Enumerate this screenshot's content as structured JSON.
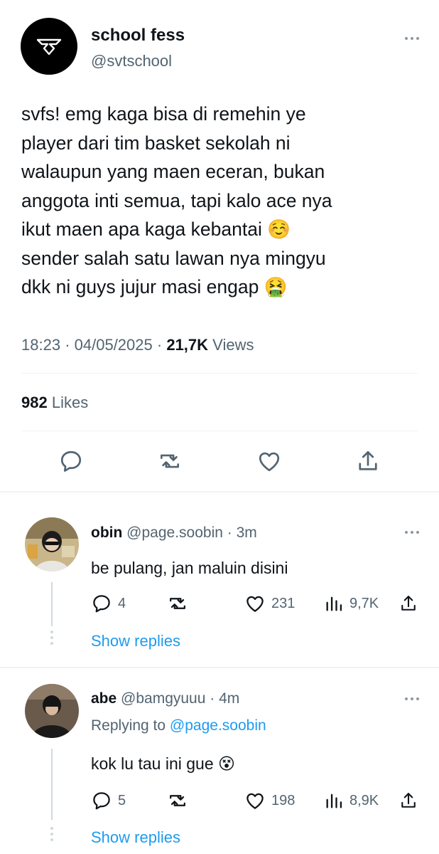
{
  "tweet": {
    "display_name": "school fess",
    "handle": "@svtschool",
    "text_lines": [
      "svfs! emg kaga bisa di remehin ye",
      "player dari tim basket sekolah ni",
      "walaupun yang maen eceran, bukan",
      "anggota inti semua, tapi kalo ace nya",
      "ikut maen apa kaga kebantai ☺️",
      "sender salah satu lawan nya mingyu",
      "dkk ni guys jujur masi engap 🤮"
    ],
    "time": "18:23",
    "date": "04/05/2025",
    "views_count": "21,7K",
    "views_label": "Views",
    "likes_count": "982",
    "likes_label": "Likes",
    "separator": "·"
  },
  "replies": [
    {
      "name": "obin",
      "handle": "@page.soobin",
      "time": "3m",
      "text": "be pulang, jan maluin disini",
      "comments": "4",
      "likes": "231",
      "views": "9,7K",
      "show_replies": "Show replies"
    },
    {
      "name": "abe",
      "handle": "@bamgyuuu",
      "time": "4m",
      "replying_prefix": "Replying to",
      "replying_to": "@page.soobin",
      "text": "kok lu tau ini gue 😵",
      "comments": "5",
      "likes": "198",
      "views": "8,9K",
      "show_replies": "Show replies"
    }
  ],
  "colors": {
    "accent": "#1d9bf0",
    "secondary_text": "#536471",
    "primary_text": "#0f1419"
  },
  "icons": [
    "more-icon",
    "reply-icon",
    "retweet-icon",
    "like-icon",
    "share-icon",
    "views-icon"
  ]
}
